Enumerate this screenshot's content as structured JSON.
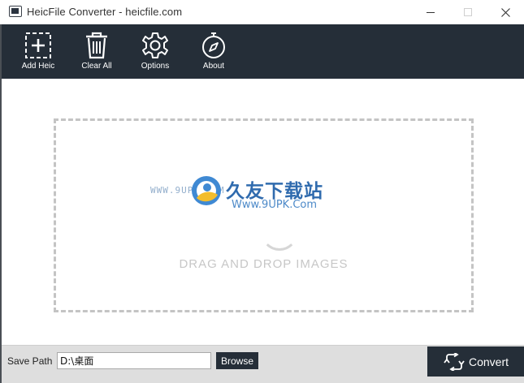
{
  "window": {
    "title": "HeicFile Converter - heicfile.com",
    "controls": [
      "minimize",
      "maximize",
      "close"
    ]
  },
  "toolbar": {
    "items": [
      {
        "label": "Add Heic",
        "icon": "add-box-icon"
      },
      {
        "label": "Clear All",
        "icon": "trash-icon"
      },
      {
        "label": "Options",
        "icon": "gear-icon"
      },
      {
        "label": "About",
        "icon": "compass-icon"
      }
    ]
  },
  "dropzone": {
    "text": "DRAG AND DROP IMAGES"
  },
  "watermark": {
    "www": "WWW.9UPK.COM",
    "cn": "久友下载站",
    "url": "Www.9UPK.Com"
  },
  "bottom": {
    "save_label": "Save Path",
    "save_value": "D:\\桌面",
    "browse_label": "Browse",
    "convert_label": "Convert"
  },
  "colors": {
    "toolbar_bg": "#252e38",
    "bottom_bg": "#dedede",
    "dropzone_border": "#c4c4c4"
  }
}
